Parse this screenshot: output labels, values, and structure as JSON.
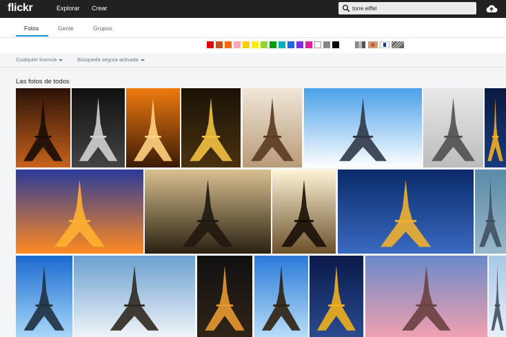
{
  "header": {
    "logo": "flickr",
    "nav": [
      "Explorar",
      "Crear"
    ],
    "search_value": "torre eiffel"
  },
  "tabs": [
    "Fotos",
    "Gente",
    "Grupos"
  ],
  "active_tab": "Fotos",
  "color_filters": [
    "#e00000",
    "#c0501c",
    "#ff6a00",
    "#f8a7b4",
    "#ffcc00",
    "#ffee00",
    "#99d22c",
    "#00a000",
    "#00b0c0",
    "#1e6bd6",
    "#7b2ee0",
    "#e020a0",
    "#ffffff",
    "#888888",
    "#000000"
  ],
  "style_filters": [
    "black-and-white",
    "shallow-depth-of-field",
    "minimalist",
    "patterns"
  ],
  "filters": {
    "license": "Cualquier licencia",
    "safe_search": "Búsqueda segura activada"
  },
  "section_title": "Las fotos de todos",
  "photos": [
    {
      "name": "orange framed tower",
      "sky": [
        "#2a1208",
        "#c8621c"
      ],
      "tower": "#1a0d05"
    },
    {
      "name": "black and white tower",
      "sky": [
        "#101010",
        "#444444"
      ],
      "tower": "#d0d0d0"
    },
    {
      "name": "tower in orange fog",
      "sky": [
        "#f07a10",
        "#3a1a05"
      ],
      "tower": "#ffd080"
    },
    {
      "name": "illuminated tower night",
      "sky": [
        "#1a1206",
        "#4a3210"
      ],
      "tower": "#f2c040"
    },
    {
      "name": "tower sepia low angle",
      "sky": [
        "#f0e6d8",
        "#b89a78"
      ],
      "tower": "#5a3a20"
    },
    {
      "name": "tower from below blue sky",
      "sky": [
        "#4aa0e8",
        "#ffffff"
      ],
      "tower": "#303848"
    },
    {
      "name": "tower winter trees",
      "sky": [
        "#e8e8e8",
        "#bcbcbc"
      ],
      "tower": "#505050"
    },
    {
      "name": "tower edge blue",
      "sky": [
        "#0a1a40",
        "#1a3a80"
      ],
      "tower": "#f2b020"
    },
    {
      "name": "tower sunset purple sky",
      "sky": [
        "#2a3a9a",
        "#ff8a20"
      ],
      "tower": "#ffb030"
    },
    {
      "name": "tower from below dark brown",
      "sky": [
        "#d8c090",
        "#2a2010"
      ],
      "tower": "#201810"
    },
    {
      "name": "tower silhouette vignette",
      "sky": [
        "#fff4d8",
        "#6a5028"
      ],
      "tower": "#181008"
    },
    {
      "name": "tower blue hour river",
      "sky": [
        "#0a2a6a",
        "#3a6ac0"
      ],
      "tower": "#f0b030"
    },
    {
      "name": "tower edge teal",
      "sky": [
        "#5a8aa8",
        "#9ab8c8"
      ],
      "tower": "#405060"
    },
    {
      "name": "tower blue sky green lawn",
      "sky": [
        "#1a6ad0",
        "#a8d8f8"
      ],
      "tower": "#203040"
    },
    {
      "name": "tower from below clouds",
      "sky": [
        "#6aa0d0",
        "#f0f4f8"
      ],
      "tower": "#302820"
    },
    {
      "name": "framed tower night",
      "sky": [
        "#101010",
        "#302418"
      ],
      "tower": "#e89830"
    },
    {
      "name": "tower bright blue",
      "sky": [
        "#2a7ad8",
        "#b8ddf8"
      ],
      "tower": "#302010"
    },
    {
      "name": "tower night gold",
      "sky": [
        "#0a1a4a",
        "#2a4a90"
      ],
      "tower": "#f0b020"
    },
    {
      "name": "tower trocadero dusk",
      "sky": [
        "#6a8ac8",
        "#f0a0b0"
      ],
      "tower": "#6a4040"
    },
    {
      "name": "tower edge light",
      "sky": [
        "#a8c8e8",
        "#e8f0f8"
      ],
      "tower": "#405060"
    }
  ]
}
